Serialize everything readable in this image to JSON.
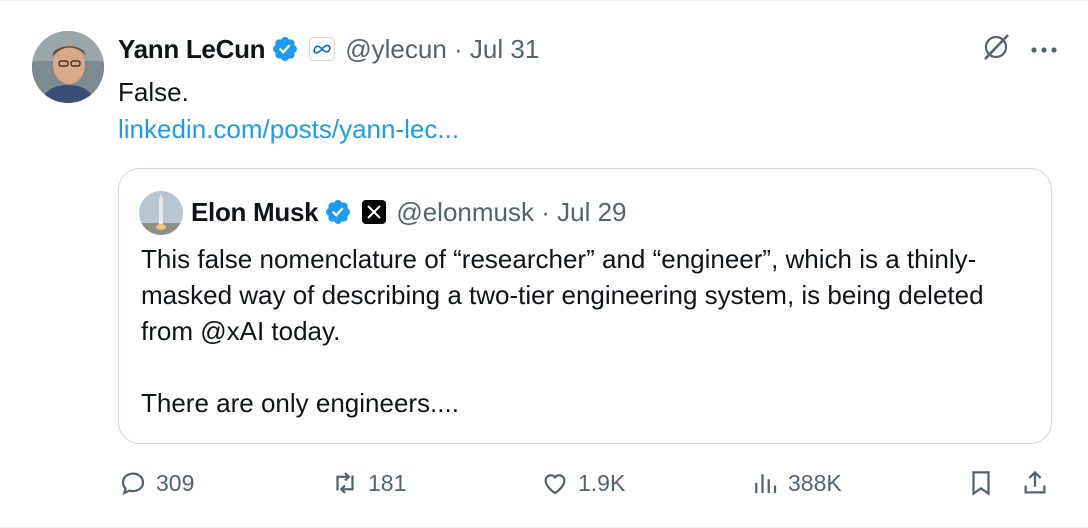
{
  "author": {
    "name": "Yann LeCun",
    "handle": "@ylecun",
    "date": "Jul 31",
    "verified": true,
    "affiliation_icon": "meta-icon"
  },
  "body": {
    "text": "False.",
    "link": "linkedin.com/posts/yann-lec..."
  },
  "quoted": {
    "name": "Elon Musk",
    "handle": "@elonmusk",
    "date": "Jul 29",
    "verified": true,
    "affiliation_icon": "x-logo-icon",
    "paragraph1": "This false nomenclature of “researcher” and “engineer”, which is a thinly-masked way of describing a two-tier engineering system, is being deleted from @xAI today.",
    "paragraph2": "There are only engineers...."
  },
  "stats": {
    "replies": "309",
    "reposts": "181",
    "likes": "1.9K",
    "views": "388K"
  },
  "icons": [
    "grok-icon",
    "more-icon",
    "reply-icon",
    "repost-icon",
    "like-icon",
    "views-icon",
    "bookmark-icon",
    "share-icon"
  ],
  "colors": {
    "link": "#1d9bf0",
    "verified": "#1d9bf0",
    "muted": "#536471",
    "border": "#cfd9de"
  }
}
